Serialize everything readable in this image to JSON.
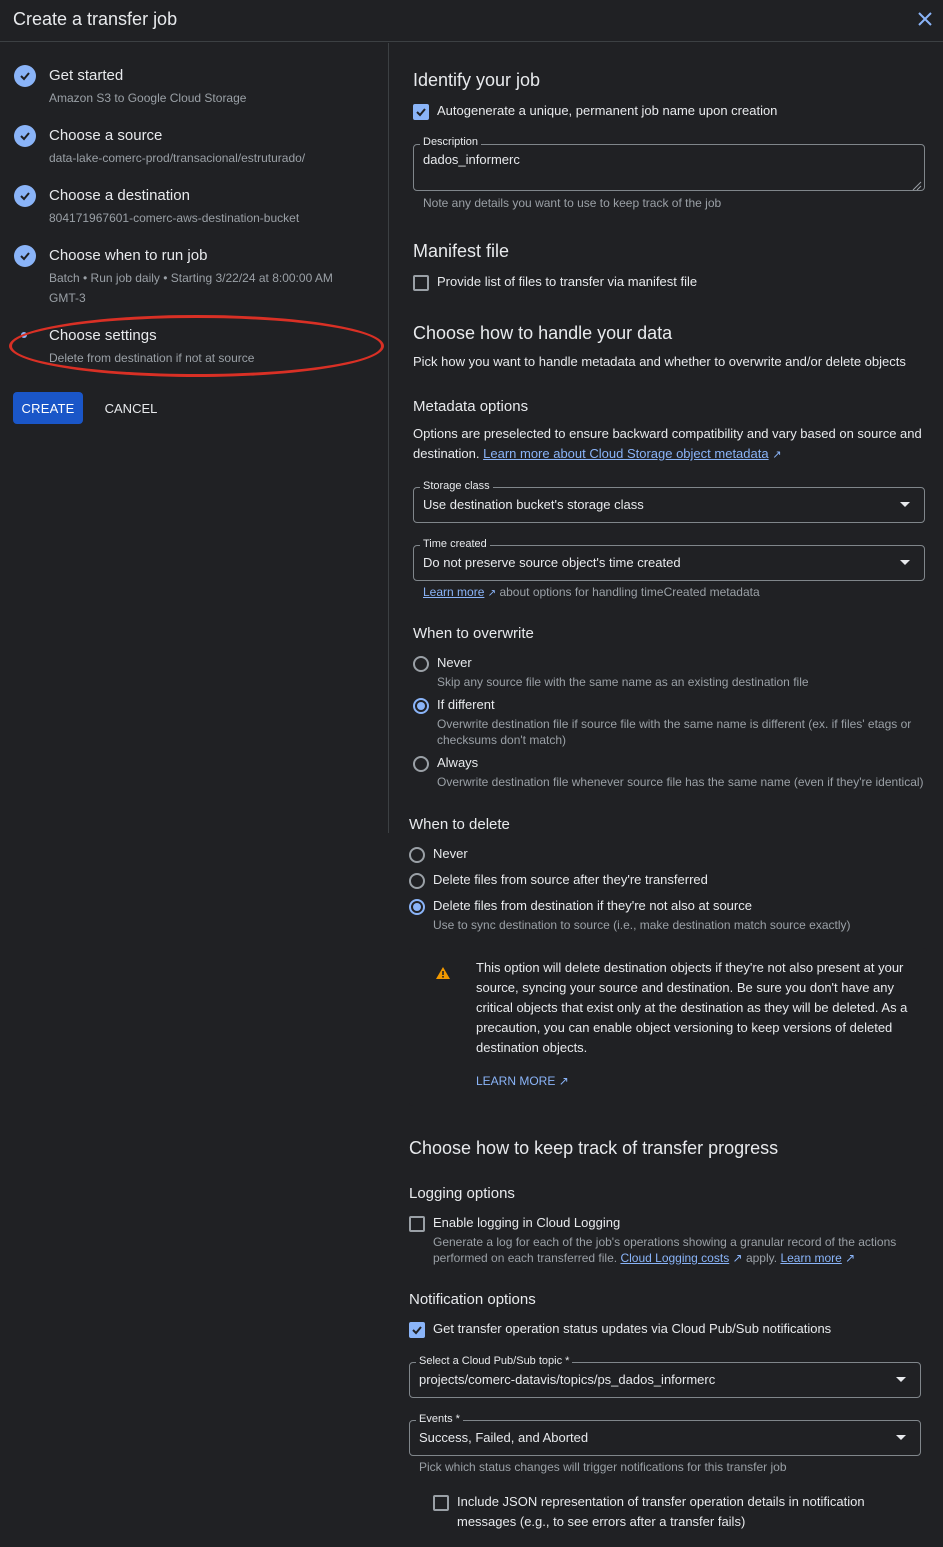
{
  "header": {
    "title": "Create a transfer job",
    "close_icon": "close-icon"
  },
  "steps": [
    {
      "title": "Get started",
      "sub": "Amazon S3 to Google Cloud Storage"
    },
    {
      "title": "Choose a source",
      "sub": "data-lake-comerc-prod/transacional/estruturado/"
    },
    {
      "title": "Choose a destination",
      "sub": "804171967601-comerc-aws-destination-bucket"
    },
    {
      "title": "Choose when to run job",
      "sub1": "Batch • Run job daily • Starting 3/22/24 at 8:00:00 AM",
      "sub2": "GMT-3"
    },
    {
      "title": "Choose settings",
      "sub": "Delete from destination if not at source"
    }
  ],
  "actions": {
    "create": "CREATE",
    "cancel": "CANCEL"
  },
  "identify": {
    "heading": "Identify your job",
    "autogen_label": "Autogenerate a unique, permanent job name upon creation",
    "desc_label": "Description",
    "desc_value": "dados_informerc",
    "desc_hint": "Note any details you want to use to keep track of the job"
  },
  "manifest": {
    "heading": "Manifest file",
    "label": "Provide list of files to transfer via manifest file"
  },
  "handle": {
    "heading": "Choose how to handle your data",
    "sub": "Pick how you want to handle metadata and whether to overwrite and/or delete objects"
  },
  "metadata": {
    "heading": "Metadata options",
    "text1": "Options are preselected to ensure backward compatibility and vary based on source and",
    "text2": "destination.",
    "link": "Learn more about Cloud Storage object metadata",
    "storage_label": "Storage class",
    "storage_value": "Use destination bucket's storage class",
    "time_label": "Time created",
    "time_value": "Do not preserve source object's time created",
    "time_hint_link": "Learn more",
    "time_hint": "about options for handling timeCreated metadata"
  },
  "overwrite": {
    "heading": "When to overwrite",
    "never": "Never",
    "never_sub": "Skip any source file with the same name as an existing destination file",
    "different": "If different",
    "different_sub1": "Overwrite destination file if source file with the same name is different (ex. if files' etags or",
    "different_sub2": "checksums don't match)",
    "always": "Always",
    "always_sub": "Overwrite destination file whenever source file has the same name (even if they're identical)"
  },
  "delete": {
    "heading": "When to delete",
    "never": "Never",
    "after": "Delete files from source after they're transferred",
    "dest": "Delete files from destination if they're not also at source",
    "dest_sub": "Use to sync destination to source (i.e., make destination match source exactly)",
    "warn_lines": [
      "This option will delete destination objects if they're not also present at your",
      "source, syncing your source and destination. Be sure you don't have any",
      "critical objects that exist only at the destination as they will be deleted. As a",
      "precaution, you can enable object versioning to keep versions of deleted",
      "destination objects."
    ],
    "warn_link": "LEARN MORE"
  },
  "tracking": {
    "heading": "Choose how to keep track of transfer progress"
  },
  "logging": {
    "heading": "Logging options",
    "label": "Enable logging in Cloud Logging",
    "sub1": "Generate a log for each of the job's operations showing a granular record of the actions",
    "sub2": "performed on each transferred file.",
    "cost_link": "Cloud Logging costs",
    "apply": "apply.",
    "learn": "Learn more"
  },
  "notification": {
    "heading": "Notification options",
    "label": "Get transfer operation status updates via Cloud Pub/Sub notifications",
    "topic_label": "Select a Cloud Pub/Sub topic *",
    "topic_value": "projects/comerc-datavis/topics/ps_dados_informerc",
    "events_label": "Events *",
    "events_value": "Success, Failed, and Aborted",
    "events_hint": "Pick which status changes will trigger notifications for this transfer job",
    "json_label1": "Include JSON representation of transfer operation details in notification",
    "json_label2": "messages (e.g., to see errors after a transfer fails)"
  }
}
